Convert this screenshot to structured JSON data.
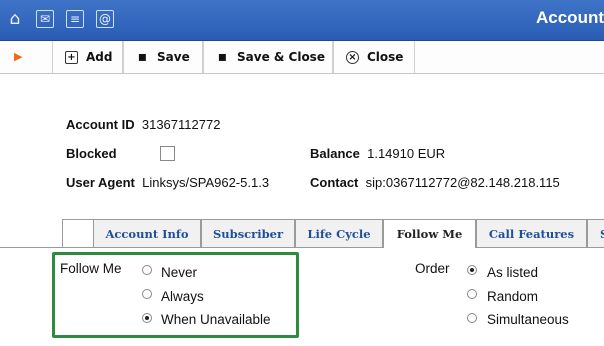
{
  "header": {
    "title": "Account",
    "icons": [
      "home-icon",
      "mail-icon",
      "list-icon",
      "at-icon"
    ]
  },
  "toolbar": {
    "add_label": "Add",
    "save_label": "Save",
    "save_close_label": "Save & Close",
    "close_label": "Close"
  },
  "account": {
    "id_label": "Account ID",
    "id_value": "31367112772",
    "blocked_label": "Blocked",
    "blocked_checked": false,
    "balance_label": "Balance",
    "balance_value": "1.14910 EUR",
    "user_agent_label": "User Agent",
    "user_agent_value": "Linksys/SPA962-5.1.3",
    "contact_label": "Contact",
    "contact_value": "sip:0367112772@82.148.218.115"
  },
  "tabs": [
    {
      "label": "Account Info",
      "active": false
    },
    {
      "label": "Subscriber",
      "active": false
    },
    {
      "label": "Life Cycle",
      "active": false
    },
    {
      "label": "Follow Me",
      "active": true
    },
    {
      "label": "Call Features",
      "active": false
    },
    {
      "label": "S",
      "active": false
    }
  ],
  "follow_me": {
    "label": "Follow Me",
    "options": [
      {
        "label": "Never",
        "selected": false
      },
      {
        "label": "Always",
        "selected": false
      },
      {
        "label": "When Unavailable",
        "selected": true
      }
    ]
  },
  "order": {
    "label": "Order",
    "options": [
      {
        "label": "As listed",
        "selected": true
      },
      {
        "label": "Random",
        "selected": false
      },
      {
        "label": "Simultaneous",
        "selected": false
      }
    ]
  },
  "colors": {
    "header_bg": "#2f63bb",
    "tab_text": "#1f4f9a",
    "highlight_border": "#2e8b3d",
    "play_marker": "#ee6a12"
  }
}
